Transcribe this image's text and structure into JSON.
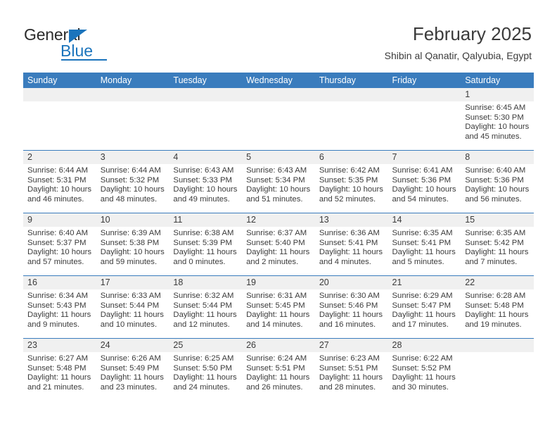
{
  "brand": {
    "name_part1": "General",
    "name_part2": "Blue",
    "triangle_color": "#1b74bc",
    "text_color": "#2b2b2b"
  },
  "header": {
    "title": "February 2025",
    "subtitle": "Shibin al Qanatir, Qalyubia, Egypt"
  },
  "theme": {
    "accent": "#3a7cbd",
    "daynum_band": "#f0f0f0",
    "text": "#3b3b3b"
  },
  "weekdays": [
    "Sunday",
    "Monday",
    "Tuesday",
    "Wednesday",
    "Thursday",
    "Friday",
    "Saturday"
  ],
  "labels": {
    "sunrise_prefix": "Sunrise:",
    "sunset_prefix": "Sunset:",
    "daylight_prefix": "Daylight:"
  },
  "weeks": [
    [
      {
        "day": "",
        "sunrise": "",
        "sunset": "",
        "daylight_line1": "",
        "daylight_line2": ""
      },
      {
        "day": "",
        "sunrise": "",
        "sunset": "",
        "daylight_line1": "",
        "daylight_line2": ""
      },
      {
        "day": "",
        "sunrise": "",
        "sunset": "",
        "daylight_line1": "",
        "daylight_line2": ""
      },
      {
        "day": "",
        "sunrise": "",
        "sunset": "",
        "daylight_line1": "",
        "daylight_line2": ""
      },
      {
        "day": "",
        "sunrise": "",
        "sunset": "",
        "daylight_line1": "",
        "daylight_line2": ""
      },
      {
        "day": "",
        "sunrise": "",
        "sunset": "",
        "daylight_line1": "",
        "daylight_line2": ""
      },
      {
        "day": "1",
        "sunrise": "Sunrise: 6:45 AM",
        "sunset": "Sunset: 5:30 PM",
        "daylight_line1": "Daylight: 10 hours",
        "daylight_line2": "and 45 minutes."
      }
    ],
    [
      {
        "day": "2",
        "sunrise": "Sunrise: 6:44 AM",
        "sunset": "Sunset: 5:31 PM",
        "daylight_line1": "Daylight: 10 hours",
        "daylight_line2": "and 46 minutes."
      },
      {
        "day": "3",
        "sunrise": "Sunrise: 6:44 AM",
        "sunset": "Sunset: 5:32 PM",
        "daylight_line1": "Daylight: 10 hours",
        "daylight_line2": "and 48 minutes."
      },
      {
        "day": "4",
        "sunrise": "Sunrise: 6:43 AM",
        "sunset": "Sunset: 5:33 PM",
        "daylight_line1": "Daylight: 10 hours",
        "daylight_line2": "and 49 minutes."
      },
      {
        "day": "5",
        "sunrise": "Sunrise: 6:43 AM",
        "sunset": "Sunset: 5:34 PM",
        "daylight_line1": "Daylight: 10 hours",
        "daylight_line2": "and 51 minutes."
      },
      {
        "day": "6",
        "sunrise": "Sunrise: 6:42 AM",
        "sunset": "Sunset: 5:35 PM",
        "daylight_line1": "Daylight: 10 hours",
        "daylight_line2": "and 52 minutes."
      },
      {
        "day": "7",
        "sunrise": "Sunrise: 6:41 AM",
        "sunset": "Sunset: 5:36 PM",
        "daylight_line1": "Daylight: 10 hours",
        "daylight_line2": "and 54 minutes."
      },
      {
        "day": "8",
        "sunrise": "Sunrise: 6:40 AM",
        "sunset": "Sunset: 5:36 PM",
        "daylight_line1": "Daylight: 10 hours",
        "daylight_line2": "and 56 minutes."
      }
    ],
    [
      {
        "day": "9",
        "sunrise": "Sunrise: 6:40 AM",
        "sunset": "Sunset: 5:37 PM",
        "daylight_line1": "Daylight: 10 hours",
        "daylight_line2": "and 57 minutes."
      },
      {
        "day": "10",
        "sunrise": "Sunrise: 6:39 AM",
        "sunset": "Sunset: 5:38 PM",
        "daylight_line1": "Daylight: 10 hours",
        "daylight_line2": "and 59 minutes."
      },
      {
        "day": "11",
        "sunrise": "Sunrise: 6:38 AM",
        "sunset": "Sunset: 5:39 PM",
        "daylight_line1": "Daylight: 11 hours",
        "daylight_line2": "and 0 minutes."
      },
      {
        "day": "12",
        "sunrise": "Sunrise: 6:37 AM",
        "sunset": "Sunset: 5:40 PM",
        "daylight_line1": "Daylight: 11 hours",
        "daylight_line2": "and 2 minutes."
      },
      {
        "day": "13",
        "sunrise": "Sunrise: 6:36 AM",
        "sunset": "Sunset: 5:41 PM",
        "daylight_line1": "Daylight: 11 hours",
        "daylight_line2": "and 4 minutes."
      },
      {
        "day": "14",
        "sunrise": "Sunrise: 6:35 AM",
        "sunset": "Sunset: 5:41 PM",
        "daylight_line1": "Daylight: 11 hours",
        "daylight_line2": "and 5 minutes."
      },
      {
        "day": "15",
        "sunrise": "Sunrise: 6:35 AM",
        "sunset": "Sunset: 5:42 PM",
        "daylight_line1": "Daylight: 11 hours",
        "daylight_line2": "and 7 minutes."
      }
    ],
    [
      {
        "day": "16",
        "sunrise": "Sunrise: 6:34 AM",
        "sunset": "Sunset: 5:43 PM",
        "daylight_line1": "Daylight: 11 hours",
        "daylight_line2": "and 9 minutes."
      },
      {
        "day": "17",
        "sunrise": "Sunrise: 6:33 AM",
        "sunset": "Sunset: 5:44 PM",
        "daylight_line1": "Daylight: 11 hours",
        "daylight_line2": "and 10 minutes."
      },
      {
        "day": "18",
        "sunrise": "Sunrise: 6:32 AM",
        "sunset": "Sunset: 5:44 PM",
        "daylight_line1": "Daylight: 11 hours",
        "daylight_line2": "and 12 minutes."
      },
      {
        "day": "19",
        "sunrise": "Sunrise: 6:31 AM",
        "sunset": "Sunset: 5:45 PM",
        "daylight_line1": "Daylight: 11 hours",
        "daylight_line2": "and 14 minutes."
      },
      {
        "day": "20",
        "sunrise": "Sunrise: 6:30 AM",
        "sunset": "Sunset: 5:46 PM",
        "daylight_line1": "Daylight: 11 hours",
        "daylight_line2": "and 16 minutes."
      },
      {
        "day": "21",
        "sunrise": "Sunrise: 6:29 AM",
        "sunset": "Sunset: 5:47 PM",
        "daylight_line1": "Daylight: 11 hours",
        "daylight_line2": "and 17 minutes."
      },
      {
        "day": "22",
        "sunrise": "Sunrise: 6:28 AM",
        "sunset": "Sunset: 5:48 PM",
        "daylight_line1": "Daylight: 11 hours",
        "daylight_line2": "and 19 minutes."
      }
    ],
    [
      {
        "day": "23",
        "sunrise": "Sunrise: 6:27 AM",
        "sunset": "Sunset: 5:48 PM",
        "daylight_line1": "Daylight: 11 hours",
        "daylight_line2": "and 21 minutes."
      },
      {
        "day": "24",
        "sunrise": "Sunrise: 6:26 AM",
        "sunset": "Sunset: 5:49 PM",
        "daylight_line1": "Daylight: 11 hours",
        "daylight_line2": "and 23 minutes."
      },
      {
        "day": "25",
        "sunrise": "Sunrise: 6:25 AM",
        "sunset": "Sunset: 5:50 PM",
        "daylight_line1": "Daylight: 11 hours",
        "daylight_line2": "and 24 minutes."
      },
      {
        "day": "26",
        "sunrise": "Sunrise: 6:24 AM",
        "sunset": "Sunset: 5:51 PM",
        "daylight_line1": "Daylight: 11 hours",
        "daylight_line2": "and 26 minutes."
      },
      {
        "day": "27",
        "sunrise": "Sunrise: 6:23 AM",
        "sunset": "Sunset: 5:51 PM",
        "daylight_line1": "Daylight: 11 hours",
        "daylight_line2": "and 28 minutes."
      },
      {
        "day": "28",
        "sunrise": "Sunrise: 6:22 AM",
        "sunset": "Sunset: 5:52 PM",
        "daylight_line1": "Daylight: 11 hours",
        "daylight_line2": "and 30 minutes."
      },
      {
        "day": "",
        "sunrise": "",
        "sunset": "",
        "daylight_line1": "",
        "daylight_line2": ""
      }
    ]
  ]
}
